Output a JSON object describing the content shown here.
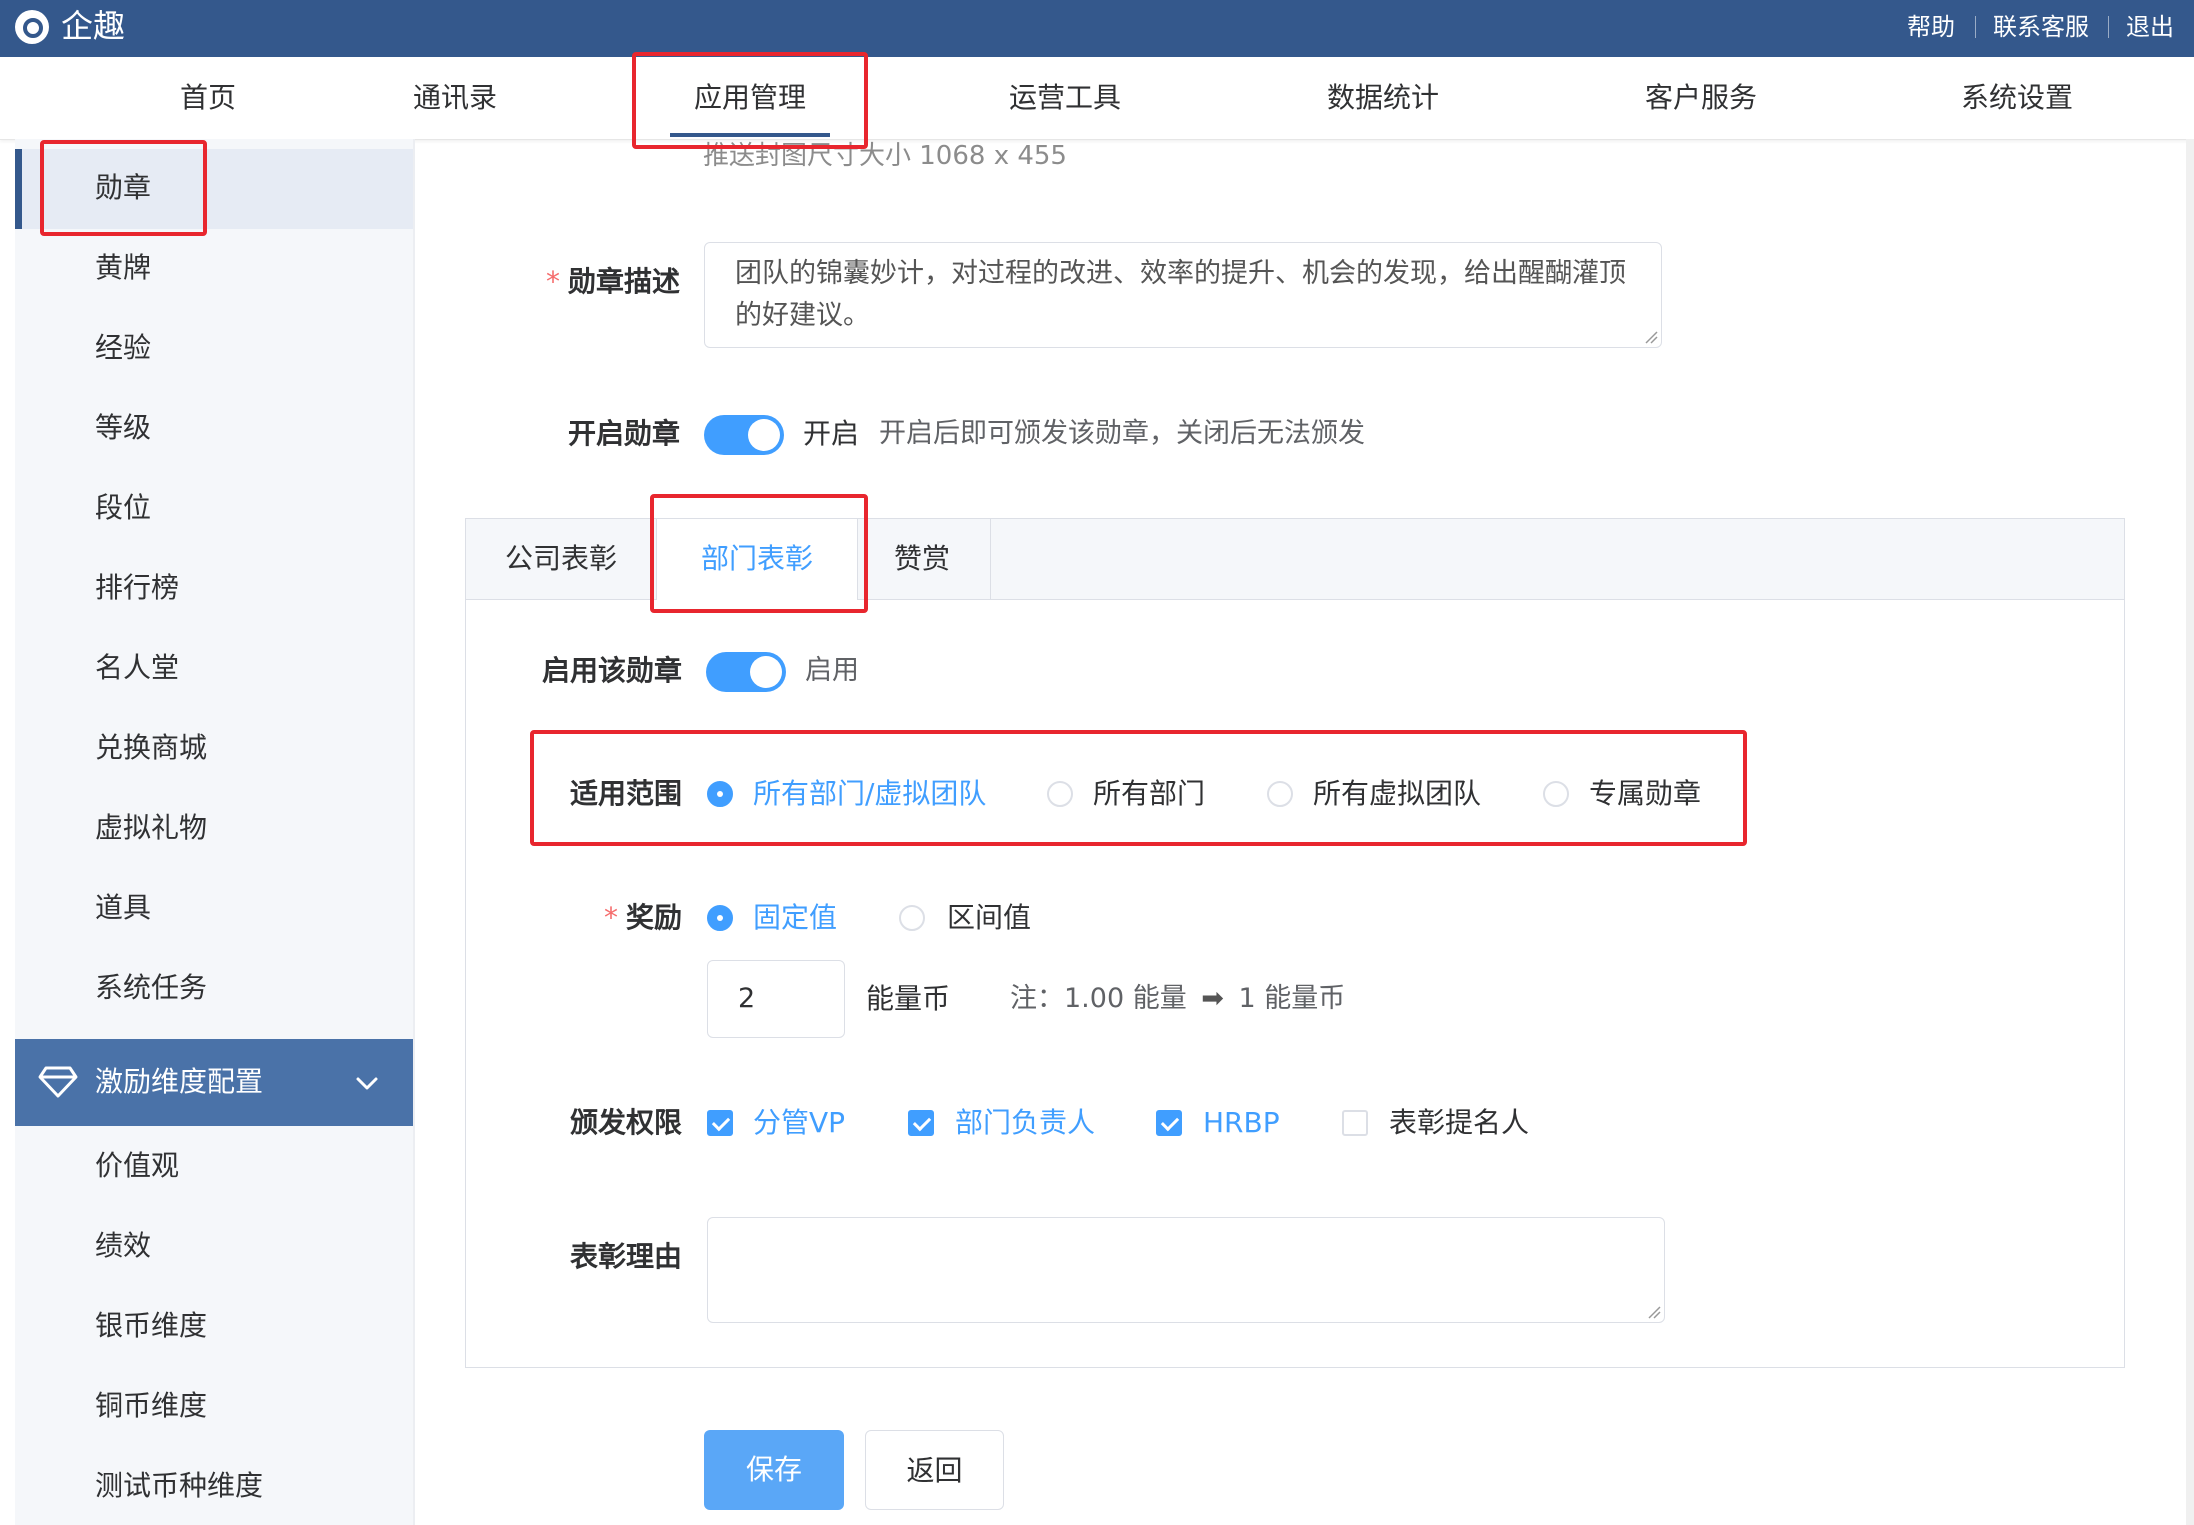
{
  "app": {
    "name": "企趣"
  },
  "top_links": {
    "help": "帮助",
    "contact": "联系客服",
    "logout": "退出"
  },
  "nav": {
    "items": [
      "首页",
      "通讯录",
      "应用管理",
      "运营工具",
      "数据统计",
      "客户服务",
      "系统设置"
    ],
    "active": "应用管理"
  },
  "sidebar": {
    "items": [
      "勋章",
      "黄牌",
      "经验",
      "等级",
      "段位",
      "排行榜",
      "名人堂",
      "兑换商城",
      "虚拟礼物",
      "道具",
      "系统任务"
    ],
    "active": "勋章",
    "group": {
      "label": "激励维度配置",
      "icon": "gem-icon",
      "expand_icon": "chevron-down-icon"
    },
    "group_items": [
      "价值观",
      "绩效",
      "银币维度",
      "铜币维度",
      "测试币种维度"
    ]
  },
  "form": {
    "push_hint": "推送封图尺寸大小 1068 x 455",
    "description": {
      "required_mark": "*",
      "label": "勋章描述",
      "value": "团队的锦囊妙计，对过程的改进、效率的提升、机会的发现，给出醒醐灌顶的好建议。"
    },
    "enable_medal": {
      "label": "开启勋章",
      "state_text": "开启",
      "hint": "开启后即可颁发该勋章，关闭后无法颁发"
    }
  },
  "tabs": {
    "items": [
      "公司表彰",
      "部门表彰",
      "赞赏"
    ],
    "active": "部门表彰"
  },
  "tab_content": {
    "enable": {
      "label": "启用该勋章",
      "state_text": "启用"
    },
    "scope": {
      "label": "适用范围",
      "options": [
        "所有部门/虚拟团队",
        "所有部门",
        "所有虚拟团队",
        "专属勋章"
      ],
      "selected": "所有部门/虚拟团队"
    },
    "reward": {
      "required_mark": "*",
      "label": "奖励",
      "options": [
        "固定值",
        "区间值"
      ],
      "selected": "固定值",
      "value": "2",
      "unit": "能量币",
      "note_prefix": "注：1.00 能量",
      "note_arrow": "➡",
      "note_suffix": "1 能量币"
    },
    "permission": {
      "label": "颁发权限",
      "options": [
        {
          "label": "分管VP",
          "checked": true
        },
        {
          "label": "部门负责人",
          "checked": true
        },
        {
          "label": "HRBP",
          "checked": true
        },
        {
          "label": "表彰提名人",
          "checked": false
        }
      ]
    },
    "reason": {
      "label": "表彰理由",
      "value": ""
    }
  },
  "buttons": {
    "save": "保存",
    "back": "返回"
  },
  "colors": {
    "topbar": "#34588c",
    "accent": "#409eff",
    "annotation": "#e8262e",
    "sidebar_group": "#4a72a8"
  }
}
